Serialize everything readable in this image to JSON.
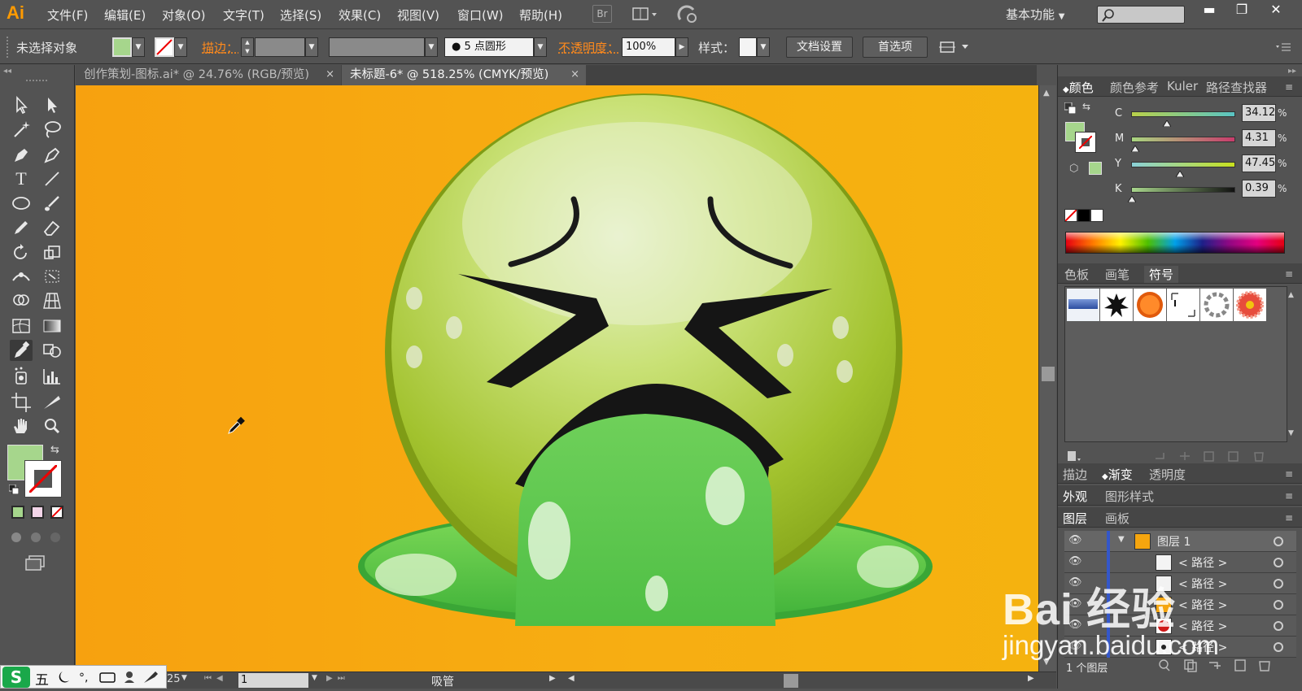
{
  "app": {
    "logo": "Ai"
  },
  "menu": [
    "文件(F)",
    "编辑(E)",
    "对象(O)",
    "文字(T)",
    "选择(S)",
    "效果(C)",
    "视图(V)",
    "窗口(W)",
    "帮助(H)"
  ],
  "menu_icons": {
    "bridge": "Br"
  },
  "workspace": {
    "label": "基本功能"
  },
  "window_buttons": {
    "minimize": "▬",
    "restore": "❐",
    "close": "✕"
  },
  "control_bar": {
    "selection_status": "未选择对象",
    "stroke_label": "描边：",
    "brush_value": "5 点圆形",
    "opacity_label": "不透明度：",
    "opacity_value": "100%",
    "style_label": "样式：",
    "doc_setup_button": "文档设置",
    "preferences_button": "首选项"
  },
  "doc_tabs": [
    {
      "title": "创作策划-图标.ai* @ 24.76% (RGB/预览)",
      "close": "×",
      "active": false
    },
    {
      "title": "未标题-6* @ 518.25% (CMYK/预览)",
      "close": "×",
      "active": true
    }
  ],
  "color_panel": {
    "tabs": [
      "颜色",
      "颜色参考",
      "Kuler",
      "路径查找器"
    ],
    "channels": [
      {
        "name": "C",
        "value": "34.12",
        "level": 0.34
      },
      {
        "name": "M",
        "value": "4.31",
        "level": 0.04
      },
      {
        "name": "Y",
        "value": "47.45",
        "level": 0.47
      },
      {
        "name": "K",
        "value": "0.39",
        "level": 0.004
      }
    ],
    "percent": "%"
  },
  "symbols_panel": {
    "tabs": [
      "色板",
      "画笔",
      "符号"
    ]
  },
  "bottom_panels": {
    "row1": [
      "描边",
      "渐变",
      "透明度"
    ],
    "row2": [
      "外观",
      "图形样式"
    ],
    "row3": [
      "图层",
      "画板"
    ]
  },
  "layers": [
    {
      "name": "图层 1",
      "top": true
    },
    {
      "name": "< 路径 >"
    },
    {
      "name": "< 路径 >"
    },
    {
      "name": "< 路径 >"
    },
    {
      "name": "< 路径 >"
    },
    {
      "name": "< 路径 >"
    }
  ],
  "layers_status": "1 个图层",
  "status_bar": {
    "zoom": "25",
    "page": "1",
    "tool": "吸管"
  },
  "ime": {
    "label": "五"
  },
  "watermark": {
    "brand": "Bai 经验",
    "url": "jingyan.baidu.com"
  },
  "colors": {
    "fill": "#a6d68c",
    "accent": "#ff9a00",
    "canvas": "#f7a80f"
  }
}
